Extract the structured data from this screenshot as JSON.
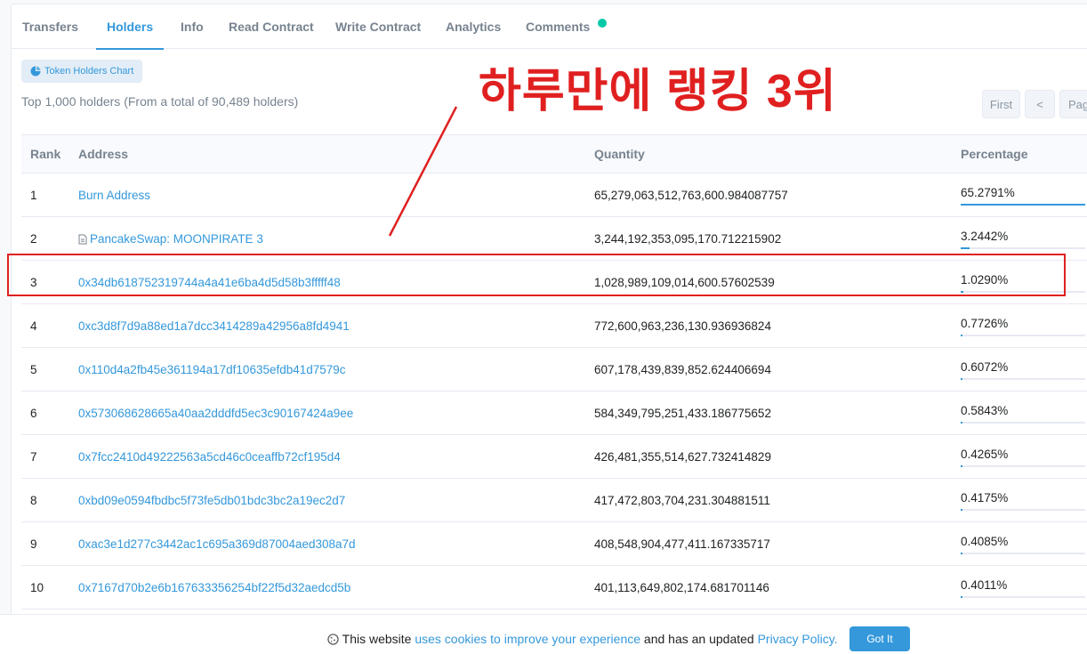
{
  "tabs": [
    {
      "label": "Transfers",
      "active": false
    },
    {
      "label": "Holders",
      "active": true
    },
    {
      "label": "Info",
      "active": false
    },
    {
      "label": "Read Contract",
      "active": false
    },
    {
      "label": "Write Contract",
      "active": false
    },
    {
      "label": "Analytics",
      "active": false
    },
    {
      "label": "Comments",
      "active": false
    }
  ],
  "chart_button": "Token Holders Chart",
  "summary": "Top 1,000 holders (From a total of 90,489 holders)",
  "pager": {
    "first": "First",
    "prev": "<",
    "page": "Page"
  },
  "overlay_title": "하루만에 랭킹 3위",
  "table": {
    "headers": {
      "rank": "Rank",
      "address": "Address",
      "quantity": "Quantity",
      "percentage": "Percentage"
    },
    "rows": [
      {
        "rank": "1",
        "address": "Burn Address",
        "contract": false,
        "quantity": "65,279,063,512,763,600.984087757",
        "percentage": "65.2791%",
        "pct": 65.2791
      },
      {
        "rank": "2",
        "address": "PancakeSwap: MOONPIRATE 3",
        "contract": true,
        "quantity": "3,244,192,353,095,170.712215902",
        "percentage": "3.2442%",
        "pct": 3.2442
      },
      {
        "rank": "3",
        "address": "0x34db618752319744a4a41e6ba4d5d58b3fffff48",
        "contract": false,
        "quantity": "1,028,989,109,014,600.57602539",
        "percentage": "1.0290%",
        "pct": 1.029
      },
      {
        "rank": "4",
        "address": "0xc3d8f7d9a88ed1a7dcc3414289a42956a8fd4941",
        "contract": false,
        "quantity": "772,600,963,236,130.936936824",
        "percentage": "0.7726%",
        "pct": 0.7726
      },
      {
        "rank": "5",
        "address": "0x110d4a2fb45e361194a17df10635efdb41d7579c",
        "contract": false,
        "quantity": "607,178,439,839,852.624406694",
        "percentage": "0.6072%",
        "pct": 0.6072
      },
      {
        "rank": "6",
        "address": "0x573068628665a40aa2dddfd5ec3c90167424a9ee",
        "contract": false,
        "quantity": "584,349,795,251,433.186775652",
        "percentage": "0.5843%",
        "pct": 0.5843
      },
      {
        "rank": "7",
        "address": "0x7fcc2410d49222563a5cd46c0ceaffb72cf195d4",
        "contract": false,
        "quantity": "426,481,355,514,627.732414829",
        "percentage": "0.4265%",
        "pct": 0.4265
      },
      {
        "rank": "8",
        "address": "0xbd09e0594fbdbc5f73fe5db01bdc3bc2a19ec2d7",
        "contract": false,
        "quantity": "417,472,803,704,231.304881511",
        "percentage": "0.4175%",
        "pct": 0.4175
      },
      {
        "rank": "9",
        "address": "0xac3e1d277c3442ac1c695a369d87004aed308a7d",
        "contract": false,
        "quantity": "408,548,904,477,411.167335717",
        "percentage": "0.4085%",
        "pct": 0.4085
      },
      {
        "rank": "10",
        "address": "0x7167d70b2e6b167633356254bf22f5d32aedcd5b",
        "contract": false,
        "quantity": "401,113,649,802,174.681701146",
        "percentage": "0.4011%",
        "pct": 0.4011
      }
    ]
  },
  "cookie": {
    "prefix": "This website ",
    "link1": "uses cookies to improve your experience",
    "middle": " and has an updated ",
    "link2": "Privacy Policy.",
    "button": "Got It"
  },
  "colors": {
    "accent": "#3498db",
    "annotation": "#e02020",
    "dot": "#00c9a7"
  }
}
